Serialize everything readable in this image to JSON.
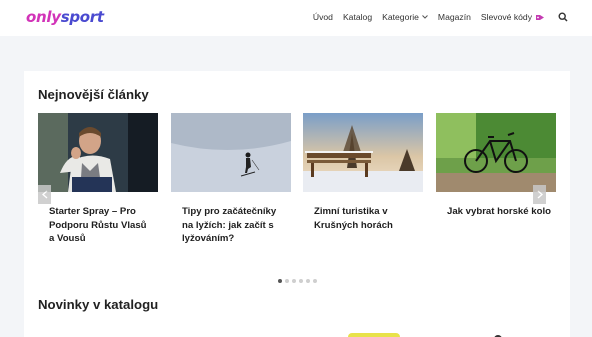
{
  "brand": {
    "part1": "only",
    "part2": "sport"
  },
  "nav": {
    "items": [
      "Úvod",
      "Katalog",
      "Kategorie",
      "Magazín",
      "Slevové kódy"
    ]
  },
  "sections": {
    "latest_title": "Nejnovější články",
    "catalog_title": "Novinky v katalogu"
  },
  "articles": [
    {
      "title": "Starter Spray – Pro Podporu Růstu Vlasů a Vousů"
    },
    {
      "title": "Tipy pro začátečníky na lyžích: jak začít s lyžováním?"
    },
    {
      "title": "Zimní turistika v Krušných horách"
    },
    {
      "title": "Jak vybrat horské kolo"
    }
  ],
  "carousel": {
    "dots": 7,
    "active_index": 0
  },
  "colors": {
    "brand_pink": "#d233b8",
    "brand_blue": "#4a4ad0",
    "background": "#f3f5f8"
  },
  "icons": [
    "chevron-down-icon",
    "tag-icon",
    "search-icon",
    "arrow-left-icon",
    "arrow-right-icon"
  ]
}
